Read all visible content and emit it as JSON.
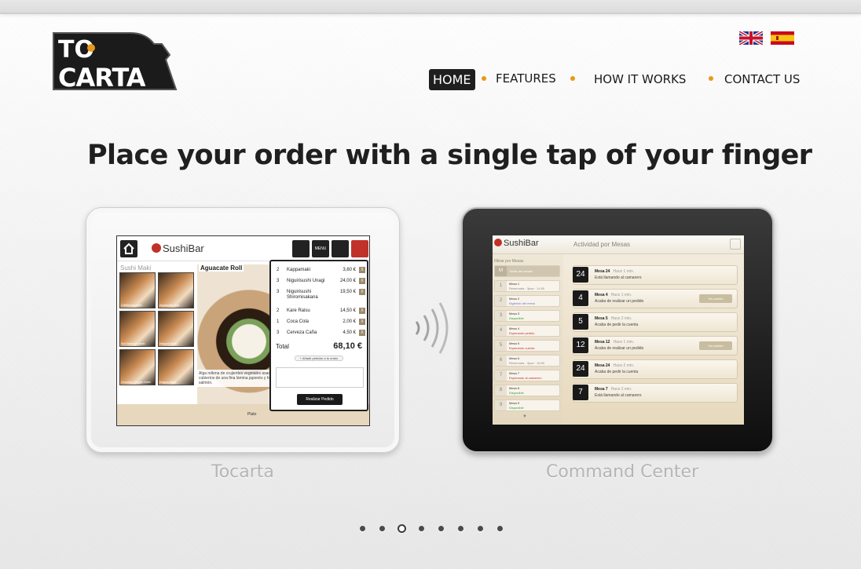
{
  "logo": {
    "text_top": "TO",
    "text_bottom": "CARTA"
  },
  "languages": [
    {
      "name": "uk-flag-icon"
    },
    {
      "name": "spain-flag-icon"
    }
  ],
  "nav": {
    "home": "HOME",
    "features": "FEATURES",
    "how_it_works": "HOW IT WORKS",
    "contact_us": "CONTACT US"
  },
  "headline": "Place your order with a single tap of your finger",
  "slides": {
    "left_caption": "Tocarta",
    "right_caption": "Command Center"
  },
  "pager": {
    "count": 8,
    "active_index": 2
  },
  "tocarta_screen": {
    "brand": "SushiBar",
    "category": "Sushi Maki",
    "dish_title": "Aguacate Roll",
    "dish_description": "Alga rellena de crujientes vegetales asados, cubiertos de una fina lámina japonés y huevas de salmón.",
    "thumbs": [
      "California Maki",
      "Aguacate Roll",
      "Sol Naranja Maki",
      "Negum Maki",
      "Crunchy Veggie Maki",
      "Kappa Maki"
    ],
    "order_items": [
      {
        "qty": "2",
        "name": "Kappamaki",
        "price": "3,60 €"
      },
      {
        "qty": "3",
        "name": "Niguirisushi Unagi",
        "price": "24,00 €"
      },
      {
        "qty": "3",
        "name": "Niguirisushi Shiromisakana",
        "price": "19,50 €"
      },
      {
        "qty": "2",
        "name": "Kare Raisu",
        "price": "14,50 €"
      },
      {
        "qty": "1",
        "name": "Coca Cola",
        "price": "2,00 €"
      },
      {
        "qty": "3",
        "name": "Cerveza Caña",
        "price": "4,50 €"
      }
    ],
    "total_label": "Total",
    "total_value": "68,10 €",
    "add_note": "+ Añadir petición a tu orden",
    "submit": "Realizar Pedido",
    "menu_btn": "MENU",
    "tab_plato": "Plato"
  },
  "command_screen": {
    "brand": "SushiBar",
    "section": "Actividad por Mesas",
    "filter_label": "Filtrar por Mesas",
    "all_tables": "Todas las mesas",
    "tables": [
      {
        "num": "1",
        "name": "Mesa 1",
        "status": "Reservada · 3pax · 14:00"
      },
      {
        "num": "2",
        "name": "Mesa 2",
        "status": "Elgiendo del menú"
      },
      {
        "num": "3",
        "name": "Mesa 3",
        "status": "Disponible"
      },
      {
        "num": "4",
        "name": "Mesa 4",
        "status": "Esperando pedido"
      },
      {
        "num": "5",
        "name": "Mesa 5",
        "status": "Esperando cuenta"
      },
      {
        "num": "6",
        "name": "Mesa 6",
        "status": "Reservada · 4pax · 16:00"
      },
      {
        "num": "7",
        "name": "Mesa 7",
        "status": "Esperando al camarero"
      },
      {
        "num": "8",
        "name": "Mesa 8",
        "status": "Disponible"
      },
      {
        "num": "9",
        "name": "Mesa 9",
        "status": "Disponible"
      }
    ],
    "activity": [
      {
        "num": "24",
        "title": "Mesa 24",
        "ago": "Hace 1 min.",
        "desc": "Está llamando al camarero",
        "action": ""
      },
      {
        "num": "4",
        "title": "Mesa 4",
        "ago": "Hace 1 min.",
        "desc": "Acaba de realizar un pedido",
        "action": "Ver pedido"
      },
      {
        "num": "5",
        "title": "Mesa 5",
        "ago": "Hace 2 min.",
        "desc": "Acaba de pedir la cuenta",
        "action": ""
      },
      {
        "num": "12",
        "title": "Mesa 12",
        "ago": "Hace 1 min.",
        "desc": "Acaba de realizar un pedido",
        "action": "Ver pedido"
      },
      {
        "num": "24",
        "title": "Mesa 24",
        "ago": "Hace 2 min.",
        "desc": "Acaba de pedir la cuenta",
        "action": ""
      },
      {
        "num": "7",
        "title": "Mesa 7",
        "ago": "Hace 2 min.",
        "desc": "Está llamando al camarero",
        "action": ""
      }
    ]
  },
  "colors": {
    "accent": "#e79a17",
    "nav_active_bg": "#1f1f1f",
    "caption": "#b5b5b5"
  }
}
